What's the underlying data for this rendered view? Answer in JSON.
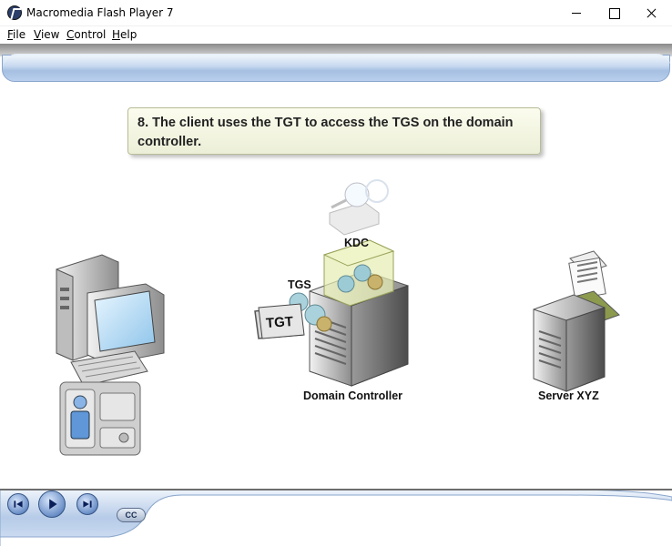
{
  "window": {
    "title": "Macromedia Flash Player 7"
  },
  "menu": {
    "items": [
      {
        "label": "File",
        "mnemonic": "F",
        "rest": "ile"
      },
      {
        "label": "View",
        "mnemonic": "V",
        "rest": "iew"
      },
      {
        "label": "Control",
        "mnemonic": "C",
        "rest": "ontrol"
      },
      {
        "label": "Help",
        "mnemonic": "H",
        "rest": "elp"
      }
    ]
  },
  "slide": {
    "caption": "8. The client uses the TGT to access the TGS on the domain controller.",
    "labels": {
      "kdc": "KDC",
      "tgs": "TGS",
      "tgt": "TGT",
      "domain_controller": "Domain Controller",
      "server": "Server XYZ"
    }
  },
  "controls": {
    "rewind_icon": "skip-back-icon",
    "play_icon": "play-icon",
    "forward_icon": "skip-forward-icon",
    "cc_label": "CC"
  },
  "colors": {
    "accent": "#6b8fc7",
    "caption_bg": "#f5f6e4"
  }
}
